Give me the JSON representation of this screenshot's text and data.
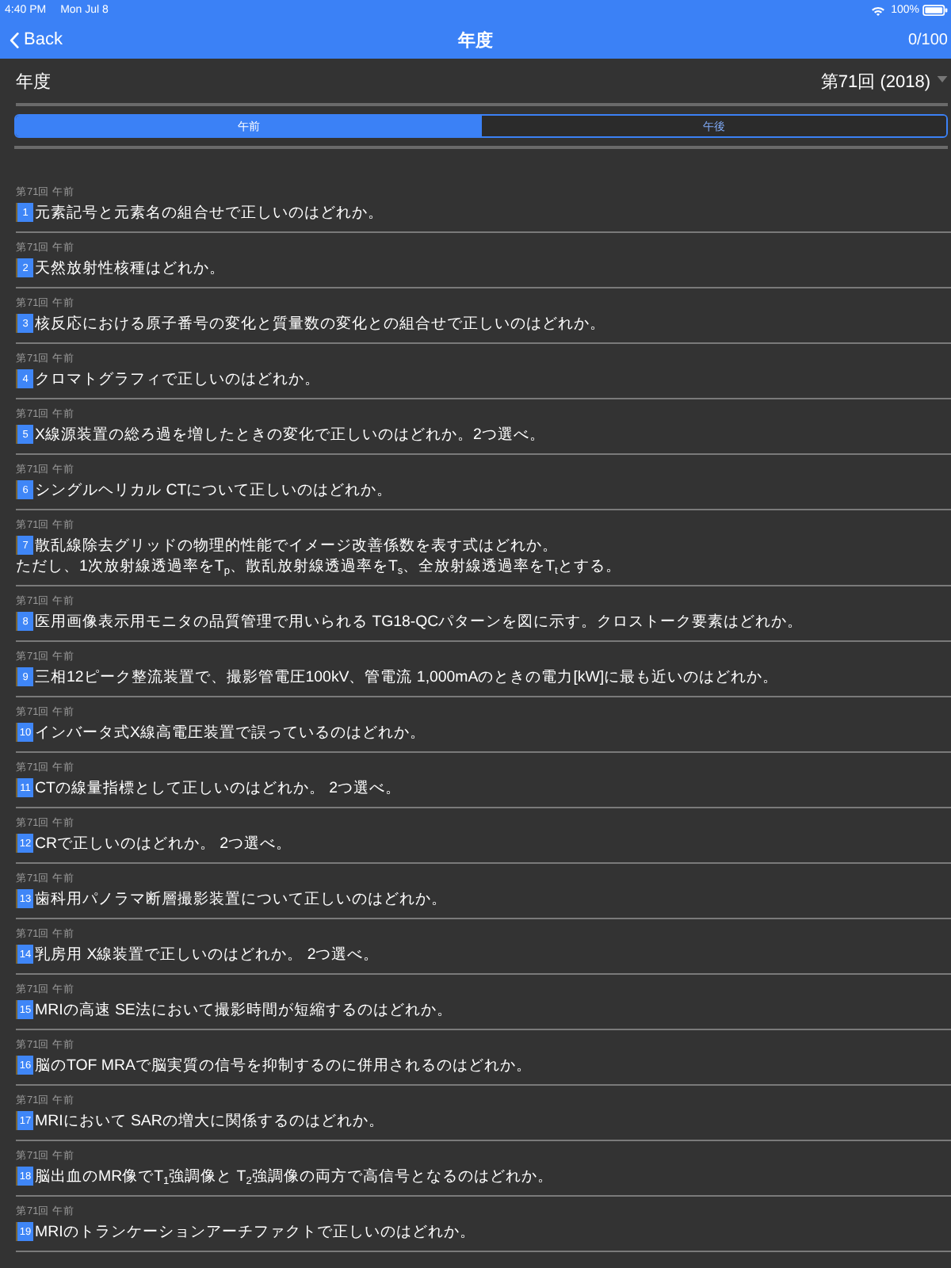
{
  "status_bar": {
    "time": "4:40 PM",
    "date": "Mon Jul 8",
    "battery": "100%"
  },
  "nav_bar": {
    "back": "Back",
    "title": "年度",
    "counter": "0/100"
  },
  "year_selector": {
    "label": "年度",
    "value": "第71回 (2018)"
  },
  "segments": [
    {
      "label": "午前",
      "selected": true
    },
    {
      "label": "午後",
      "selected": false
    }
  ],
  "questions": [
    {
      "meta": "第71回 午前",
      "number": "1",
      "text": "元素記号と元素名の組合せで正しいのはどれか。"
    },
    {
      "meta": "第71回 午前",
      "number": "2",
      "text": "天然放射性核種はどれか。"
    },
    {
      "meta": "第71回 午前",
      "number": "3",
      "text": "核反応における原子番号の変化と質量数の変化との組合せで正しいのはどれか。"
    },
    {
      "meta": "第71回 午前",
      "number": "4",
      "text": "クロマトグラフィで正しいのはどれか。"
    },
    {
      "meta": "第71回 午前",
      "number": "5",
      "text": "X線源装置の総ろ過を増したときの変化で正しいのはどれか。2つ選べ。"
    },
    {
      "meta": "第71回 午前",
      "number": "6",
      "text": "シングルヘリカル CTについて正しいのはどれか。"
    },
    {
      "meta": "第71回 午前",
      "number": "7",
      "text": "散乱線除去グリッドの物理的性能でイメージ改善係数を表す式はどれか。",
      "note": "ただし、1次放射線透過率をT$_{p}$、散乱放射線透過率をT$_{s}$、全放射線透過率をT$_{t}$とする。"
    },
    {
      "meta": "第71回 午前",
      "number": "8",
      "text": "医用画像表示用モニタの品質管理で用いられる TG18-QCパターンを図に示す。クロストーク要素はどれか。"
    },
    {
      "meta": "第71回 午前",
      "number": "9",
      "text": "三相12ピーク整流装置で、撮影管電圧100kV、管電流 1,000mAのときの電力[kW]に最も近いのはどれか。"
    },
    {
      "meta": "第71回 午前",
      "number": "10",
      "text": "インバータ式X線高電圧装置で誤っているのはどれか。"
    },
    {
      "meta": "第71回 午前",
      "number": "11",
      "text": "CTの線量指標として正しいのはどれか。 2つ選べ。"
    },
    {
      "meta": "第71回 午前",
      "number": "12",
      "text": "CRで正しいのはどれか。 2つ選べ。"
    },
    {
      "meta": "第71回 午前",
      "number": "13",
      "text": "歯科用パノラマ断層撮影装置について正しいのはどれか。"
    },
    {
      "meta": "第71回 午前",
      "number": "14",
      "text": "乳房用 X線装置で正しいのはどれか。 2つ選べ。"
    },
    {
      "meta": "第71回 午前",
      "number": "15",
      "text": "MRIの高速 SE法において撮影時間が短縮するのはどれか。"
    },
    {
      "meta": "第71回 午前",
      "number": "16",
      "text": "脳のTOF MRAで脳実質の信号を抑制するのに併用されるのはどれか。"
    },
    {
      "meta": "第71回 午前",
      "number": "17",
      "text": "MRIにおいて SARの増大に関係するのはどれか。"
    },
    {
      "meta": "第71回 午前",
      "number": "18",
      "text": "脳出血のMR像でT$_{1}$強調像と T$_{2}$強調像の両方で高信号となるのはどれか。"
    },
    {
      "meta": "第71回 午前",
      "number": "19",
      "text": "MRIのトランケーションアーチファクトで正しいのはどれか。"
    }
  ]
}
